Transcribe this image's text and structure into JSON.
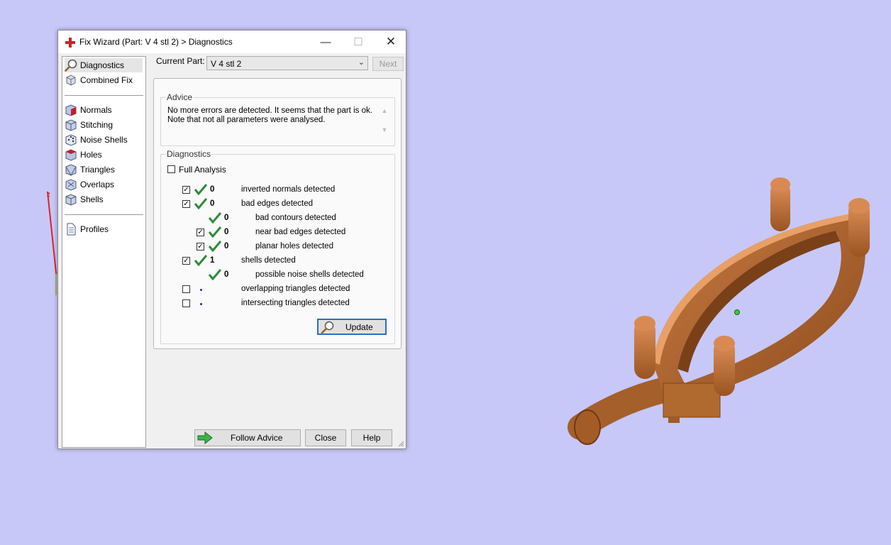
{
  "window": {
    "title": "Fix Wizard (Part: V 4 stl 2) > Diagnostics",
    "minimize": "—",
    "maximize": "☐",
    "close": "✕"
  },
  "viewport": {
    "axis_label": "z"
  },
  "sidebar": {
    "items": [
      {
        "label": "Diagnostics",
        "icon": "magnifier-icon",
        "selected": true
      },
      {
        "label": "Combined Fix",
        "icon": "box-icon"
      },
      {
        "label": "Normals",
        "icon": "normals-cube-icon"
      },
      {
        "label": "Stitching",
        "icon": "stitching-cube-icon"
      },
      {
        "label": "Noise Shells",
        "icon": "noise-dice-icon"
      },
      {
        "label": "Holes",
        "icon": "holes-cube-icon"
      },
      {
        "label": "Triangles",
        "icon": "triangles-cube-icon"
      },
      {
        "label": "Overlaps",
        "icon": "overlaps-cube-icon"
      },
      {
        "label": "Shells",
        "icon": "shells-cube-icon"
      },
      {
        "label": "Profiles",
        "icon": "document-icon"
      }
    ]
  },
  "header": {
    "current_part_label": "Current Part:",
    "current_part_value": "V 4 stl 2",
    "next_label": "Next"
  },
  "advice": {
    "title": "Advice",
    "line1": "No more errors are detected. It seems that the part is ok.",
    "line2": "Note that not all parameters were analysed."
  },
  "diagnostics": {
    "title": "Diagnostics",
    "full_analysis_label": "Full Analysis",
    "full_analysis_checked": false,
    "rows": [
      {
        "count": "0",
        "label": "inverted normals detected",
        "checked": true
      },
      {
        "count": "0",
        "label": "bad edges detected",
        "checked": true
      },
      {
        "count": "0",
        "label": "bad contours detected"
      },
      {
        "count": "0",
        "label": "near bad edges detected",
        "checked": true
      },
      {
        "count": "0",
        "label": "planar holes detected",
        "checked": true
      },
      {
        "count": "1",
        "label": "shells detected",
        "checked": true
      },
      {
        "count": "0",
        "label": "possible noise shells detected"
      },
      {
        "count": "",
        "label": "overlapping triangles detected",
        "checked": false
      },
      {
        "count": "",
        "label": "intersecting triangles detected",
        "checked": false
      }
    ],
    "update_label": "Update"
  },
  "footer": {
    "follow_advice_label": "Follow Advice",
    "close_label": "Close",
    "help_label": "Help"
  },
  "colors": {
    "background": "#c7c8f8",
    "model": "#b86a35",
    "check_green": "#2e8b3a",
    "accent": "#2b6fbf"
  }
}
